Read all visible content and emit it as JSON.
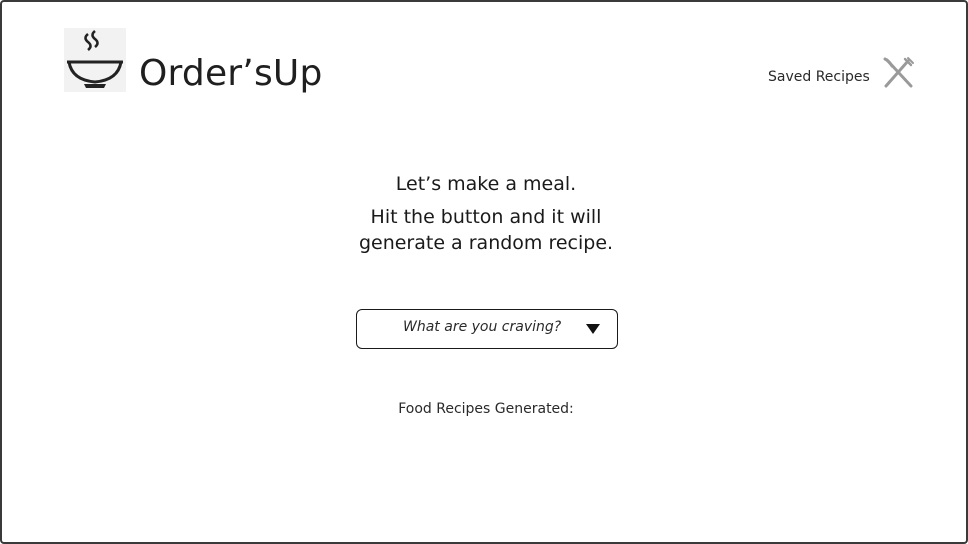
{
  "header": {
    "brand_name": "Order’sUp",
    "logo_icon": "steaming-bowl-icon",
    "saved_recipes_label": "Saved Recipes",
    "saved_recipes_icon": "fork-knife-icon"
  },
  "main": {
    "intro_line1": "Let’s make a meal.",
    "intro_line2": "Hit the button and it will generate a random recipe.",
    "craving_select": {
      "placeholder": "What are you craving?",
      "icon": "triangle-down-icon"
    },
    "recipes_generated_label": "Food Recipes Generated:"
  },
  "colors": {
    "text": "#1a1a1a",
    "frame_border": "#3a3a3a",
    "logo_background": "#f2f2f2",
    "background": "#ffffff"
  }
}
